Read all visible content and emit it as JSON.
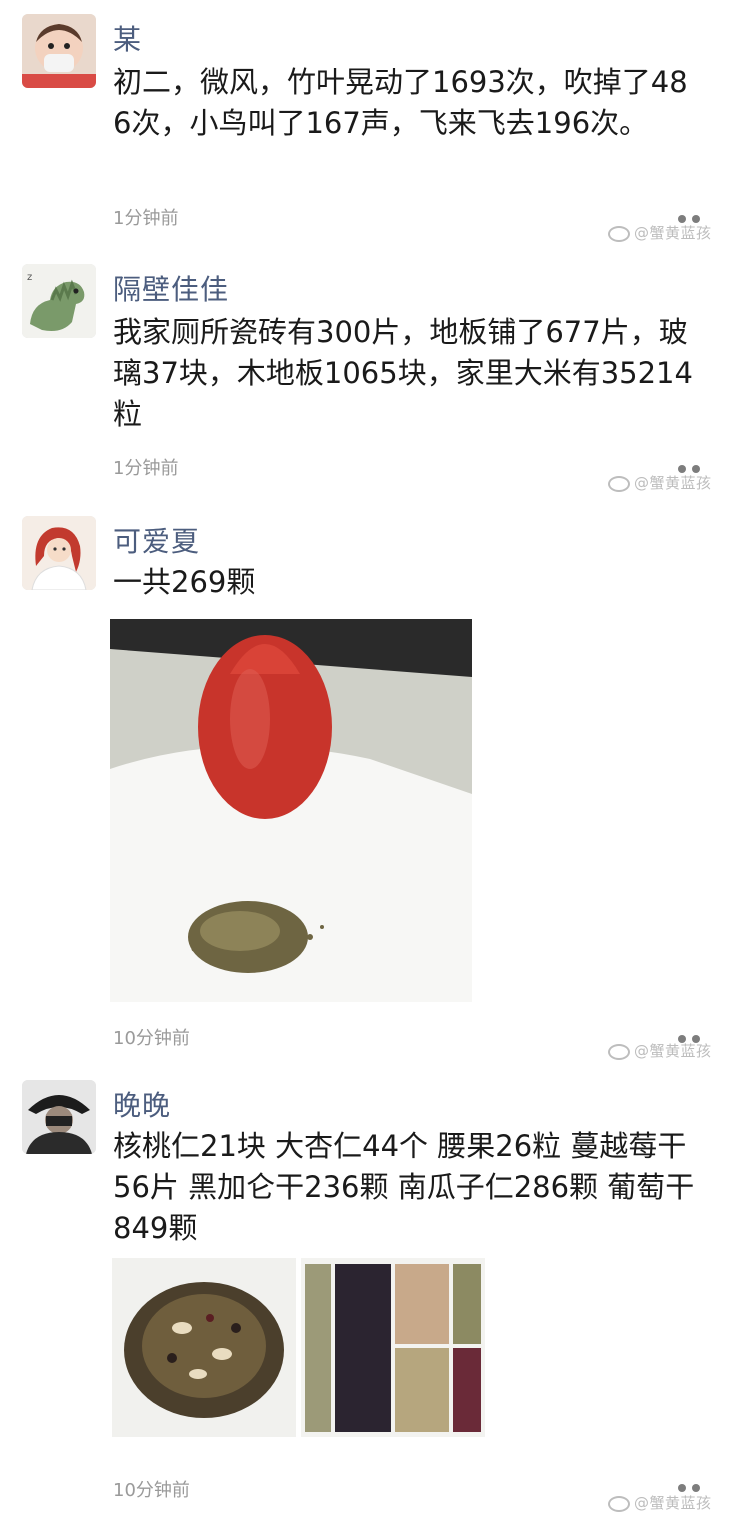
{
  "posts": [
    {
      "username": "某",
      "content": "初二，微风，竹叶晃动了1693次，吹掉了486次，小鸟叫了167声，飞来飞去196次。",
      "time": "1分钟前",
      "watermark": "@蟹黄蓝孩"
    },
    {
      "username": "隔壁佳佳",
      "content": "我家厕所瓷砖有300片，地板铺了677片，玻璃37块，木地板1065块，家里大米有35214粒",
      "time": "1分钟前",
      "watermark": "@蟹黄蓝孩"
    },
    {
      "username": "可爱夏",
      "content": "一共269颗",
      "time": "10分钟前",
      "watermark": "@蟹黄蓝孩"
    },
    {
      "username": "晚晚",
      "content": "核桃仁21块 大杏仁44个 腰果26粒 蔓越莓干56片 黑加仑干236颗 南瓜子仁286颗 葡萄干849颗",
      "time": "10分钟前",
      "watermark": "@蟹黄蓝孩"
    }
  ],
  "icons": {
    "more": "more-dots-icon",
    "weibo": "weibo-logo-icon"
  },
  "colors": {
    "username": "#4c5d7e",
    "time": "#9a9a9a",
    "strawberry": "#c8342b"
  }
}
